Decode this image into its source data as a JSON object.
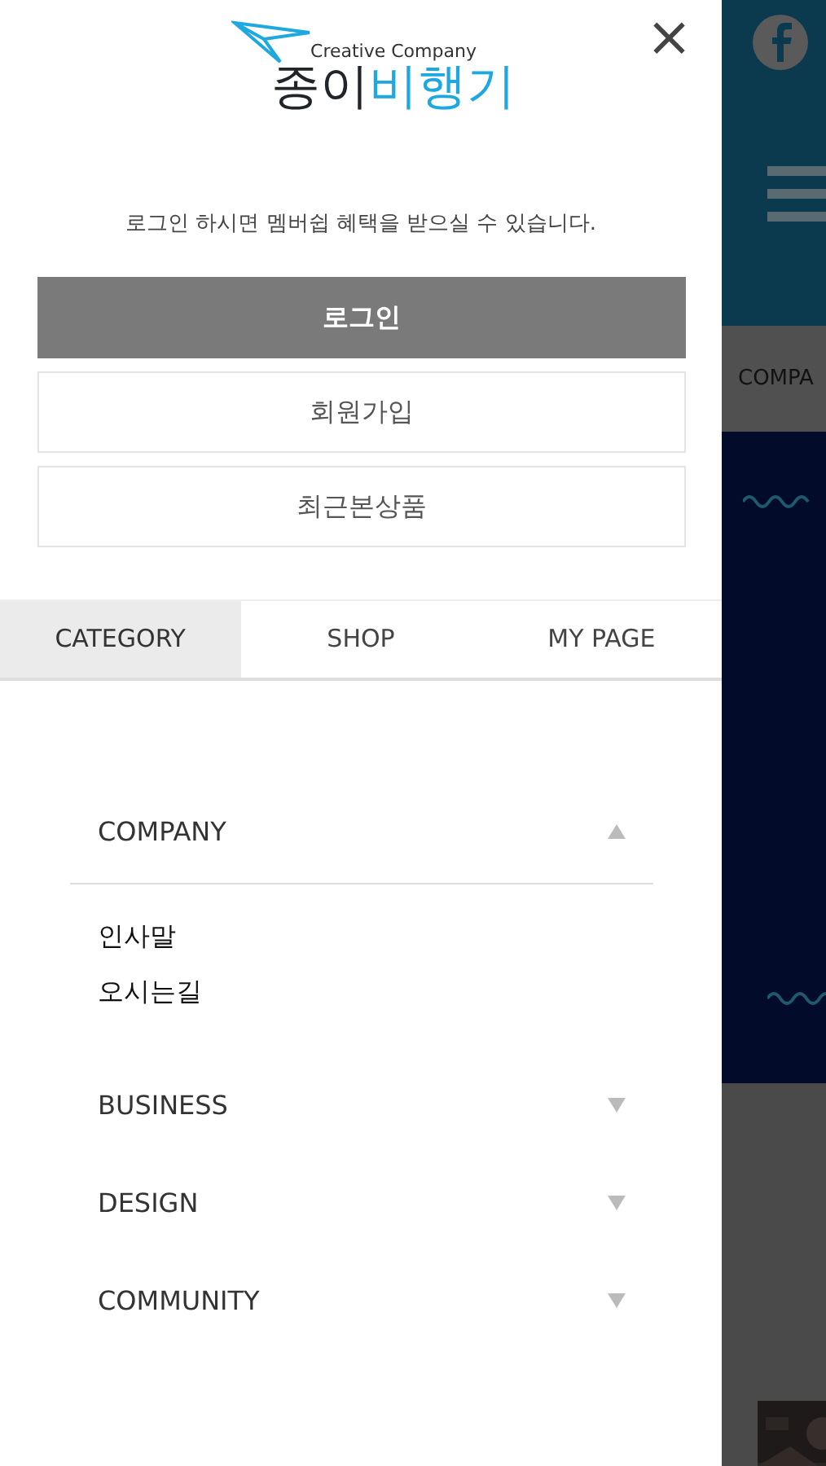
{
  "drawer": {
    "logo": {
      "tagline": "Creative Company",
      "name_main": "종이",
      "name_accent": "비행기"
    },
    "close": "×",
    "login_notice": "로그인 하시면 멤버쉽 혜택을 받으실 수 있습니다.",
    "buttons": [
      {
        "label": "로그인",
        "kind": "primary"
      },
      {
        "label": "회원가입",
        "kind": "outline"
      },
      {
        "label": "최근본상품",
        "kind": "outline"
      }
    ],
    "tabs": [
      {
        "label": "CATEGORY",
        "selected": true
      },
      {
        "label": "SHOP",
        "selected": false
      },
      {
        "label": "MY PAGE",
        "selected": false
      }
    ],
    "menu": [
      {
        "label": "COMPANY",
        "expanded": true,
        "children": [
          {
            "label": "인사말"
          },
          {
            "label": "오시는길"
          }
        ]
      },
      {
        "label": "BUSINESS",
        "expanded": false
      },
      {
        "label": "DESIGN",
        "expanded": false
      },
      {
        "label": "COMMUNITY",
        "expanded": false
      }
    ]
  },
  "background_page": {
    "nav_label": "COMPA"
  }
}
